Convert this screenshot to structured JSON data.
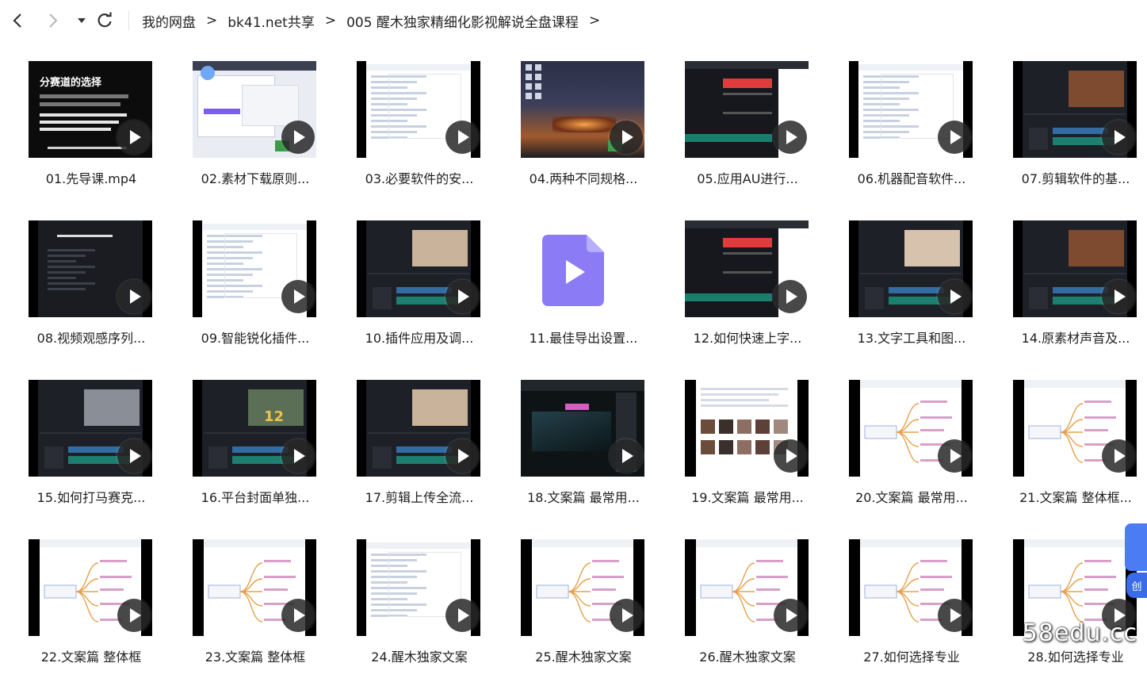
{
  "breadcrumb": [
    {
      "label": "我的网盘"
    },
    {
      "label": "bk41.net共享"
    },
    {
      "label": "005 醒木独家精细化影视解说全盘课程"
    }
  ],
  "breadcrumb_separator": ">",
  "thumb_text": {
    "t01_heading": "分赛道的选择",
    "t16_number": "12"
  },
  "files": [
    {
      "name": "01.先导课.mp4",
      "thumb": "slide"
    },
    {
      "name": "02.素材下载原则...",
      "thumb": "browser"
    },
    {
      "name": "03.必要软件的安...",
      "thumb": "doc"
    },
    {
      "name": "04.两种不同规格...",
      "thumb": "desktop"
    },
    {
      "name": "05.应用AU进行...",
      "thumb": "audio"
    },
    {
      "name": "06.机器配音软件...",
      "thumb": "doc"
    },
    {
      "name": "07.剪辑软件的基...",
      "thumb": "editor"
    },
    {
      "name": "08.视频观感序列...",
      "thumb": "dark"
    },
    {
      "name": "09.智能锐化插件...",
      "thumb": "doc"
    },
    {
      "name": "10.插件应用及调...",
      "thumb": "editor"
    },
    {
      "name": "11.最佳导出设置...",
      "thumb": "icon"
    },
    {
      "name": "12.如何快速上字...",
      "thumb": "audio"
    },
    {
      "name": "13.文字工具和图...",
      "thumb": "editor"
    },
    {
      "name": "14.原素材声音及...",
      "thumb": "editor"
    },
    {
      "name": "15.如何打马赛克...",
      "thumb": "editor"
    },
    {
      "name": "16.平台封面单独...",
      "thumb": "editor"
    },
    {
      "name": "17.剪辑上传全流...",
      "thumb": "editor"
    },
    {
      "name": "18.文案篇 最常用...",
      "thumb": "player"
    },
    {
      "name": "19.文案篇 最常用...",
      "thumb": "gallery"
    },
    {
      "name": "20.文案篇 最常用...",
      "thumb": "mindmap"
    },
    {
      "name": "21.文案篇 整体框...",
      "thumb": "mindmap"
    },
    {
      "name": "22.文案篇 整体框",
      "thumb": "mindmap"
    },
    {
      "name": "23.文案篇 整体框",
      "thumb": "mindmap"
    },
    {
      "name": "24.醒木独家文案",
      "thumb": "doc"
    },
    {
      "name": "25.醒木独家文案",
      "thumb": "mindmap"
    },
    {
      "name": "26.醒木独家文案",
      "thumb": "mindmap"
    },
    {
      "name": "27.如何选择专业",
      "thumb": "mindmap"
    },
    {
      "name": "28.如何选择专业",
      "thumb": "mindmap"
    }
  ],
  "watermark": "58edu.cc",
  "side_tab": "创",
  "colors": {
    "accent": "#4c7cf3",
    "video_icon": "#8b7cf6"
  }
}
